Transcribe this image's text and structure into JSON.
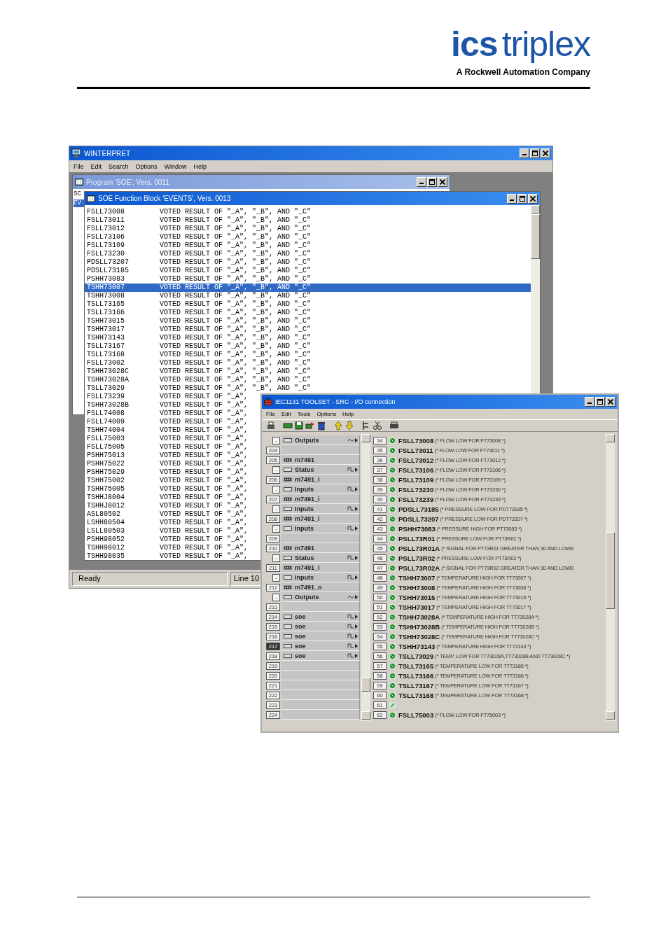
{
  "header": {
    "logo_bold": "ics",
    "logo_light": "triplex",
    "tagline": "A Rockwell Automation Company"
  },
  "winterpret": {
    "title": "WINTERPRET",
    "menu": [
      "File",
      "Edit",
      "Search",
      "Options",
      "Window",
      "Help"
    ],
    "program_window": {
      "title": "Program 'SOE', Vers. 0011",
      "side_tabs": [
        {
          "label": "SC",
          "selected": false
        },
        {
          "label": "EV",
          "selected": true
        }
      ]
    },
    "function_block": {
      "title": "SOE Function Block 'EVENTS', Vers. 0013",
      "rows": [
        {
          "tag": "FSLL73008",
          "text": "VOTED RESULT OF \"_A\", \"_B\", AND \"_C\"",
          "selected": false
        },
        {
          "tag": "FSLL73011",
          "text": "VOTED RESULT OF \"_A\", \"_B\", AND \"_C\"",
          "selected": false
        },
        {
          "tag": "FSLL73012",
          "text": "VOTED RESULT OF \"_A\", \"_B\", AND \"_C\"",
          "selected": false
        },
        {
          "tag": "FSLL73106",
          "text": "VOTED RESULT OF \"_A\", \"_B\", AND \"_C\"",
          "selected": false
        },
        {
          "tag": "FSLL73109",
          "text": "VOTED RESULT OF \"_A\", \"_B\", AND \"_C\"",
          "selected": false
        },
        {
          "tag": "FSLL73230",
          "text": "VOTED RESULT OF \"_A\", \"_B\", AND \"_C\"",
          "selected": false
        },
        {
          "tag": "PDSLL73207",
          "text": "VOTED RESULT OF \"_A\", \"_B\", AND \"_C\"",
          "selected": false
        },
        {
          "tag": "PDSLL73185",
          "text": "VOTED RESULT OF \"_A\", \"_B\", AND \"_C\"",
          "selected": false
        },
        {
          "tag": "PSHH73083",
          "text": "VOTED RESULT OF \"_A\", \"_B\", AND \"_C\"",
          "selected": false
        },
        {
          "tag": "TSHH73007",
          "text": "VOTED RESULT OF \"_A\", \"_B\", AND \"_C\"",
          "selected": true
        },
        {
          "tag": "TSHH73008",
          "text": "VOTED RESULT OF \"_A\", \"_B\", AND \"_C\"",
          "selected": false
        },
        {
          "tag": "TSLL73165",
          "text": "VOTED RESULT OF \"_A\", \"_B\", AND \"_C\"",
          "selected": false
        },
        {
          "tag": "TSLL73166",
          "text": "VOTED RESULT OF \"_A\", \"_B\", AND \"_C\"",
          "selected": false
        },
        {
          "tag": "TSHH73015",
          "text": "VOTED RESULT OF \"_A\", \"_B\", AND \"_C\"",
          "selected": false
        },
        {
          "tag": "TSHH73017",
          "text": "VOTED RESULT OF \"_A\", \"_B\", AND \"_C\"",
          "selected": false
        },
        {
          "tag": "TSHH73143",
          "text": "VOTED RESULT OF \"_A\", \"_B\", AND \"_C\"",
          "selected": false
        },
        {
          "tag": "TSLL73167",
          "text": "VOTED RESULT OF \"_A\", \"_B\", AND \"_C\"",
          "selected": false
        },
        {
          "tag": "TSLL73168",
          "text": "VOTED RESULT OF \"_A\", \"_B\", AND \"_C\"",
          "selected": false
        },
        {
          "tag": "FSLL73002",
          "text": "VOTED RESULT OF \"_A\", \"_B\", AND \"_C\"",
          "selected": false
        },
        {
          "tag": "TSHH73028C",
          "text": "VOTED RESULT OF \"_A\", \"_B\", AND \"_C\"",
          "selected": false
        },
        {
          "tag": "TSHH73028A",
          "text": "VOTED RESULT OF \"_A\", \"_B\", AND \"_C\"",
          "selected": false
        },
        {
          "tag": "TSLL73029",
          "text": "VOTED RESULT OF \"_A\", \"_B\", AND \"_C\"",
          "selected": false
        },
        {
          "tag": "FSLL73239",
          "text": "VOTED RESULT OF \"_A\",",
          "selected": false
        },
        {
          "tag": "TSHH73028B",
          "text": "VOTED RESULT OF \"_A\",",
          "selected": false
        },
        {
          "tag": "FSLL74008",
          "text": "VOTED RESULT OF \"_A\",",
          "selected": false
        },
        {
          "tag": "FSLL74009",
          "text": "VOTED RESULT OF \"_A\",",
          "selected": false
        },
        {
          "tag": "TSHH74004",
          "text": "VOTED RESULT OF \"_A\",",
          "selected": false
        },
        {
          "tag": "FSLL75003",
          "text": "VOTED RESULT OF \"_A\",",
          "selected": false
        },
        {
          "tag": "FSLL75005",
          "text": "VOTED RESULT OF \"_A\",",
          "selected": false
        },
        {
          "tag": "PSHH75013",
          "text": "VOTED RESULT OF \"_A\",",
          "selected": false
        },
        {
          "tag": "PSHH75022",
          "text": "VOTED RESULT OF \"_A\",",
          "selected": false
        },
        {
          "tag": "PSHH75029",
          "text": "VOTED RESULT OF \"_A\",",
          "selected": false
        },
        {
          "tag": "TSHH75002",
          "text": "VOTED RESULT OF \"_A\",",
          "selected": false
        },
        {
          "tag": "TSHH75005",
          "text": "VOTED RESULT OF \"_A\",",
          "selected": false
        },
        {
          "tag": "TSHHJ8004",
          "text": "VOTED RESULT OF \"_A\",",
          "selected": false
        },
        {
          "tag": "TSHHJ8012",
          "text": "VOTED RESULT OF \"_A\",",
          "selected": false
        },
        {
          "tag": "ASL80502",
          "text": "VOTED RESULT OF \"_A\",",
          "selected": false
        },
        {
          "tag": "LSHH80504",
          "text": "VOTED RESULT OF \"_A\",",
          "selected": false
        },
        {
          "tag": "LSLL80503",
          "text": "VOTED RESULT OF \"_A\",",
          "selected": false
        },
        {
          "tag": "PSHH98052",
          "text": "VOTED RESULT OF \"_A\",",
          "selected": false
        },
        {
          "tag": "TSHH98012",
          "text": "VOTED RESULT OF \"_A\",",
          "selected": false
        },
        {
          "tag": "TSHH98035",
          "text": "VOTED RESULT OF \"_A\",",
          "selected": false
        }
      ]
    },
    "status_bar": {
      "status": "Ready",
      "line": "Line 10"
    }
  },
  "toolset": {
    "title": "IEC1131 TOOLSET - SRC - I/O connection",
    "menu": [
      "File",
      "Edit",
      "Tools",
      "Options",
      "Help"
    ],
    "slots": [
      {
        "badge": "-",
        "kind": "analog_io",
        "label": "Outputs",
        "selected": false
      },
      {
        "badge": "204",
        "kind": "empty",
        "selected": false
      },
      {
        "badge": "205",
        "kind": "module",
        "label": "m7491",
        "selected": false
      },
      {
        "badge": "-",
        "kind": "digital_io",
        "label": "Status",
        "selected": false
      },
      {
        "badge": "206",
        "kind": "module",
        "label": "m7491_i",
        "selected": false
      },
      {
        "badge": "-",
        "kind": "digital_io",
        "label": "Inputs",
        "selected": false
      },
      {
        "badge": "207",
        "kind": "module",
        "label": "m7491_i",
        "selected": false
      },
      {
        "badge": "-",
        "kind": "digital_io",
        "label": "Inputs",
        "selected": false
      },
      {
        "badge": "208",
        "kind": "module",
        "label": "m7491_i",
        "selected": false
      },
      {
        "badge": "-",
        "kind": "digital_io",
        "label": "Inputs",
        "selected": false
      },
      {
        "badge": "209",
        "kind": "empty",
        "selected": false
      },
      {
        "badge": "210",
        "kind": "module",
        "label": "m7491",
        "selected": false
      },
      {
        "badge": "-",
        "kind": "digital_io",
        "label": "Status",
        "selected": false
      },
      {
        "badge": "211",
        "kind": "module",
        "label": "m7491_i",
        "selected": false
      },
      {
        "badge": "-",
        "kind": "digital_io",
        "label": "Inputs",
        "selected": false
      },
      {
        "badge": "212",
        "kind": "module",
        "label": "m7491_o",
        "selected": false
      },
      {
        "badge": "-",
        "kind": "analog_io",
        "label": "Outputs",
        "selected": false
      },
      {
        "badge": "213",
        "kind": "empty",
        "selected": false
      },
      {
        "badge": "214",
        "kind": "digital_io",
        "label": "soe",
        "selected": false
      },
      {
        "badge": "215",
        "kind": "digital_io",
        "label": "soe",
        "selected": false
      },
      {
        "badge": "216",
        "kind": "digital_io",
        "label": "soe",
        "selected": false
      },
      {
        "badge": "217",
        "kind": "digital_io",
        "label": "soe",
        "selected": true
      },
      {
        "badge": "218",
        "kind": "digital_io",
        "label": "soe",
        "selected": false
      },
      {
        "badge": "219",
        "kind": "empty",
        "selected": false
      },
      {
        "badge": "220",
        "kind": "empty",
        "selected": false
      },
      {
        "badge": "221",
        "kind": "empty",
        "selected": false
      },
      {
        "badge": "222",
        "kind": "empty",
        "selected": false
      },
      {
        "badge": "223",
        "kind": "empty",
        "selected": false
      },
      {
        "badge": "224",
        "kind": "empty",
        "selected": false
      }
    ],
    "variables": [
      {
        "number": "34",
        "kind": "variable",
        "tag": "FSLL73008",
        "comment": "(* FLOW LOW FOR FT73008 *)"
      },
      {
        "number": "35",
        "kind": "variable",
        "tag": "FSLL73011",
        "comment": "(* FLOW LOW FOR FT73011 *)"
      },
      {
        "number": "36",
        "kind": "variable",
        "tag": "FSLL73012",
        "comment": "(* FLOW LOW FOR FT73012 *)"
      },
      {
        "number": "37",
        "kind": "variable",
        "tag": "FSLL73106",
        "comment": "(* FLOW LOW FOR FT73106 *)"
      },
      {
        "number": "38",
        "kind": "variable",
        "tag": "FSLL73109",
        "comment": "(* FLOW LOW FOR FT73109 *)"
      },
      {
        "number": "39",
        "kind": "variable",
        "tag": "FSLL73230",
        "comment": "(* FLOW LOW FOR FT73230 *)"
      },
      {
        "number": "40",
        "kind": "variable",
        "tag": "FSLL73239",
        "comment": "(* FLOW LOW FOR FT73239 *)"
      },
      {
        "number": "41",
        "kind": "variable",
        "tag": "PDSLL73185",
        "comment": "(* PRESSURE LOW FOR PDT73185 *)"
      },
      {
        "number": "42",
        "kind": "variable",
        "tag": "PDSLL73207",
        "comment": "(* PRESSURE LOW FOR PDT73207 *)"
      },
      {
        "number": "43",
        "kind": "variable",
        "tag": "PSHH73083",
        "comment": "(* PRESSURE HIGH FOR PT73083 *)"
      },
      {
        "number": "44",
        "kind": "variable",
        "tag": "PSLL73R01",
        "comment": "(* PRESSURE LOW FOR PT73R01 *)"
      },
      {
        "number": "45",
        "kind": "variable",
        "tag": "PSLL73R01A",
        "comment": "(* SIGNAL FOR PT73R01 GREATER THAN 30 AND LOWE"
      },
      {
        "number": "46",
        "kind": "variable",
        "tag": "PSLL73R02",
        "comment": "(* PRESSURE LOW FOR PT73R02 *)"
      },
      {
        "number": "47",
        "kind": "variable",
        "tag": "PSLL73R02A",
        "comment": "(* SIGNAL FOR PT73R02 GREATER THAN 30 AND LOWE"
      },
      {
        "number": "48",
        "kind": "variable",
        "tag": "TSHH73007",
        "comment": "(* TEMPERATURE HIGH FOR TT73007 *)"
      },
      {
        "number": "49",
        "kind": "variable",
        "tag": "TSHH73008",
        "comment": "(* TEMPERATURE HIGH FOR TT73008 *)"
      },
      {
        "number": "50",
        "kind": "variable",
        "tag": "TSHH73015",
        "comment": "(* TEMPERATURE HIGH FOR TT73015 *)"
      },
      {
        "number": "51",
        "kind": "variable",
        "tag": "TSHH73017",
        "comment": "(* TEMPERATURE HIGH FOR TT73017 *)"
      },
      {
        "number": "52",
        "kind": "variable",
        "tag": "TSHH73028A",
        "comment": "(* TEMPERATURE HIGH FOR TT73028A *)"
      },
      {
        "number": "53",
        "kind": "variable",
        "tag": "TSHH73028B",
        "comment": "(* TEMPERATURE HIGH FOR TT73028B *)"
      },
      {
        "number": "54",
        "kind": "variable",
        "tag": "TSHH73028C",
        "comment": "(* TEMPERATURE HIGH FOR TT73028C *)"
      },
      {
        "number": "55",
        "kind": "variable",
        "tag": "TSHH73143",
        "comment": "(* TEMPERATURE HIGH FOR TT73143 *)"
      },
      {
        "number": "56",
        "kind": "variable",
        "tag": "TSLL73029",
        "comment": "(* TEMP. LOW FOR TT73028A,TT73028B AND TT73028C *)"
      },
      {
        "number": "57",
        "kind": "variable",
        "tag": "TSLL73165",
        "comment": "(* TEMPERATURE LOW FOR TT73165 *)"
      },
      {
        "number": "58",
        "kind": "variable",
        "tag": "TSLL73166",
        "comment": "(* TEMPERATURE LOW FOR TT73166 *)"
      },
      {
        "number": "59",
        "kind": "variable",
        "tag": "TSLL73167",
        "comment": "(* TEMPERATURE LOW FOR TT73167 *)"
      },
      {
        "number": "60",
        "kind": "variable",
        "tag": "TSLL73168",
        "comment": "(* TEMPERATURE LOW FOR TT73168 *)"
      },
      {
        "number": "61",
        "kind": "empty"
      },
      {
        "number": "62",
        "kind": "variable",
        "tag": "FSLL75003",
        "comment": "(* FLOW LOW FOR FT75003 *)"
      }
    ]
  }
}
